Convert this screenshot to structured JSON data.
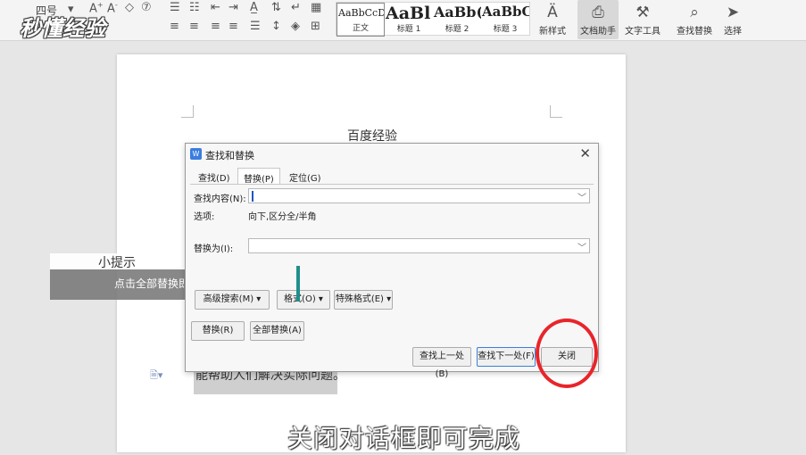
{
  "watermark": "秒懂经验",
  "ribbon": {
    "font_size": "四号",
    "styles": [
      {
        "preview": "AaBbCcDd",
        "caption": "正文"
      },
      {
        "preview": "AaBl",
        "caption": "标题 1"
      },
      {
        "preview": "AaBb(",
        "caption": "标题 2"
      },
      {
        "preview": "AaBbC",
        "caption": "标题 3"
      }
    ],
    "tools": {
      "new_style": "新样式",
      "doc_assistant": "文档助手",
      "text_tools": "文字工具",
      "find_replace": "查找替换",
      "select": "选择"
    }
  },
  "document": {
    "title": "百度经验",
    "line": "能帮助人们解决实际问题。"
  },
  "tip": {
    "title": "小提示",
    "text": "点击全部替换即可"
  },
  "dialog": {
    "title": "查找和替换",
    "tabs": [
      "查找(D)",
      "替换(P)",
      "定位(G)"
    ],
    "find_label": "查找内容(N):",
    "find_value": "",
    "options_label": "选项:",
    "options_value": "向下,区分全/半角",
    "replace_label": "替换为(I):",
    "replace_value": "",
    "btn_advanced": "高级搜索(M)",
    "btn_format": "格式(O)",
    "btn_special": "特殊格式(E)",
    "btn_replace": "替换(R)",
    "btn_replace_all": "全部替换(A)",
    "btn_prev": "查找上一处(B)",
    "btn_next": "查找下一处(F)",
    "btn_close": "关闭"
  },
  "subtitle": "关闭对话框即可完成",
  "colors": {
    "accent": "#3c7fd6",
    "annotation": "#e8252b"
  }
}
